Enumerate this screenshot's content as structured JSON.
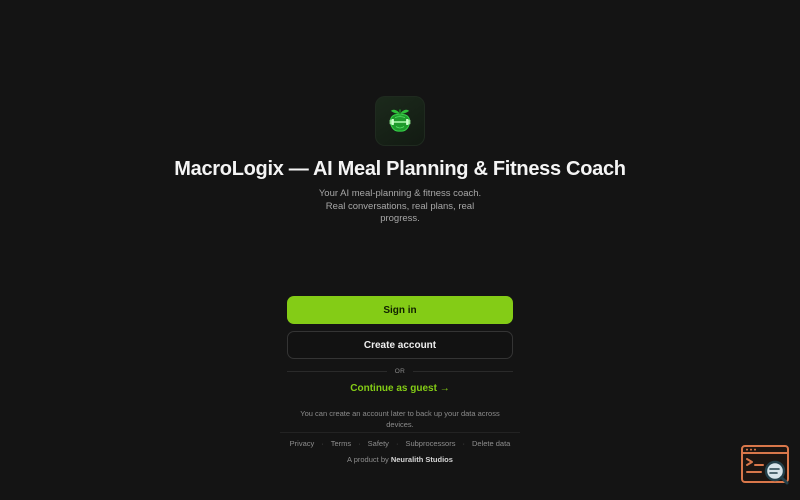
{
  "app": {
    "logo_icon": "apple-dumbbell-icon",
    "title": "MacroLogix — AI Meal Planning & Fitness Coach",
    "subtitle_line1": "Your AI meal-planning & fitness coach.",
    "subtitle_line2": "Real conversations, real plans, real",
    "subtitle_line3": "progress."
  },
  "auth": {
    "sign_in_label": "Sign in",
    "create_account_label": "Create account",
    "divider_text": "OR",
    "guest_label": "Continue as guest →",
    "note_line1": "You can create an account later to back up your data across",
    "note_line2": "devices."
  },
  "footer": {
    "links": [
      "Privacy",
      "Terms",
      "Safety",
      "Subprocessors",
      "Delete data"
    ],
    "byline_prefix": "A product by",
    "byline_studio": "Neuralith Studios"
  },
  "widget": {
    "icon": "terminal-search-icon"
  },
  "colors": {
    "background": "#141414",
    "accent": "#84cc16",
    "widget_orange": "#d9774a"
  }
}
